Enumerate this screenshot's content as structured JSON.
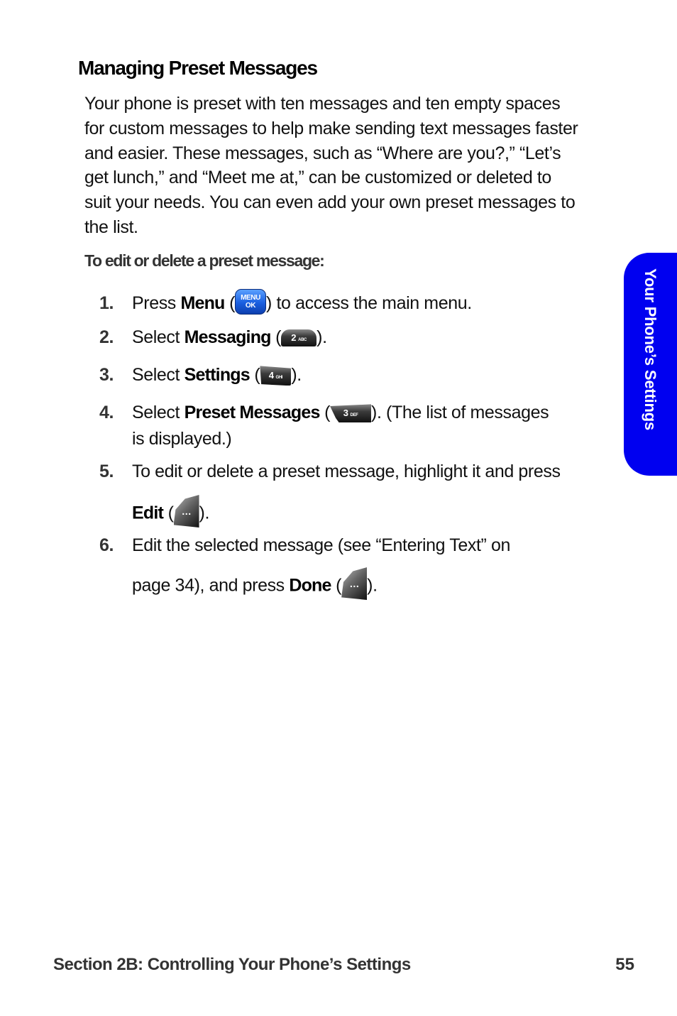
{
  "section": {
    "title": "Managing Preset Messages",
    "intro": "Your phone is preset with ten messages and ten empty spaces for custom messages to help make sending text messages faster and easier. These messages, such as “Where are you?,” “Let’s get lunch,” and “Meet me at,” can be customized or deleted to suit your needs. You can even add your own preset messages to the list.",
    "procedure_heading": "To edit or delete a preset message:"
  },
  "steps": [
    {
      "number": "1.",
      "pre": "Press ",
      "bold": "Menu",
      "key_icon": "menu-ok-key",
      "key_label_top": "MENU",
      "key_label_bottom": "OK",
      "post": " to access the main menu."
    },
    {
      "number": "2.",
      "pre": "Select ",
      "bold": "Messaging",
      "key_icon": "key-2",
      "key_digit": "2",
      "key_letters": "ABC",
      "post": "."
    },
    {
      "number": "3.",
      "pre": "Select ",
      "bold": "Settings",
      "key_icon": "key-4",
      "key_digit": "4",
      "key_letters": "GHI",
      "post": "."
    },
    {
      "number": "4.",
      "pre": "Select ",
      "bold": "Preset Messages",
      "key_icon": "key-3",
      "key_digit": "3",
      "key_letters": "DEF",
      "post": ". (The list of messages",
      "line2": "is displayed.)"
    },
    {
      "number": "5.",
      "line1": "To edit or delete a preset message, highlight it and press",
      "bold": "Edit",
      "key_icon": "softkey",
      "key_glyph": "…",
      "post": "."
    },
    {
      "number": "6.",
      "line1": "Edit the selected message (see “Entering Text” on",
      "pre": "page 34), and press ",
      "bold": "Done",
      "key_icon": "softkey",
      "key_glyph": "…",
      "post": "."
    }
  ],
  "side_tab": {
    "label": "Your Phone’s Settings",
    "color": "#0000f0"
  },
  "footer": {
    "section_label": "Section 2B: Controlling Your Phone’s Settings",
    "page_number": "55"
  }
}
